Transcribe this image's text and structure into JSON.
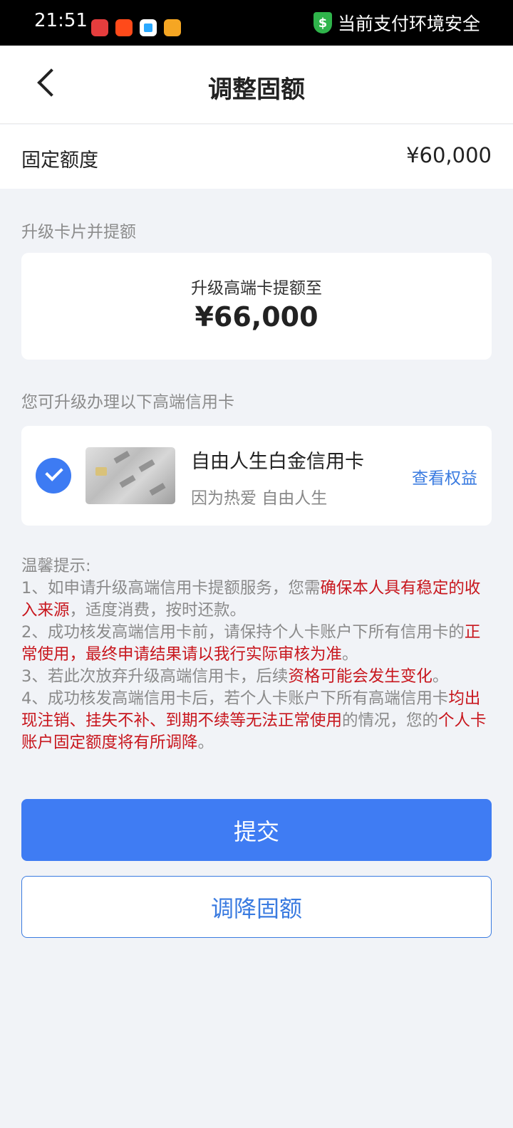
{
  "status_bar": {
    "time": "21:51",
    "security_text": "当前支付环境安全",
    "security_icon": "$",
    "app_icons": [
      "app-1-icon",
      "taobao-icon",
      "app-3-icon",
      "app-4-icon"
    ]
  },
  "nav": {
    "title": "调整固额"
  },
  "fixed_limit": {
    "label": "固定额度",
    "value": "¥60,000"
  },
  "upgrade": {
    "section_title": "升级卡片并提额",
    "subtitle": "升级高端卡提额至",
    "amount": "¥66,000"
  },
  "cards": {
    "section_title": "您可升级办理以下高端信用卡",
    "name": "自由人生白金信用卡",
    "slogan": "因为热爱 自由人生",
    "benefits_link": "查看权益"
  },
  "tips": {
    "title": "温馨提示:",
    "t1_a": "1、如申请升级高端信用卡提额服务，您需",
    "t1_red": "确保本人具有稳定的收入来源",
    "t1_b": "，适度消费，按时还款。",
    "t2_a": "2、成功核发高端信用卡前，请保持个人卡账户下所有信用卡的",
    "t2_red1": "正常使用",
    "t2_comma": "，",
    "t2_red2": "最终申请结果请以我行实际审核为准",
    "t2_b": "。",
    "t3_a": "3、若此次放弃升级高端信用卡，后续",
    "t3_red": "资格可能会发生变化",
    "t3_b": "。",
    "t4_a": "4、成功核发高端信用卡后，若个人卡账户下所有高端信用卡",
    "t4_red1": "均出现注销、挂失不补、到期不续等无法正常使用",
    "t4_b": "的情况，您的",
    "t4_red2": "个人卡账户固定额度将有所调降",
    "t4_c": "。"
  },
  "buttons": {
    "submit": "提交",
    "decrease": "调降固额"
  },
  "colors": {
    "accent": "#3f7cf3",
    "warning_red": "#c8161d",
    "background": "#f1f3f7"
  }
}
